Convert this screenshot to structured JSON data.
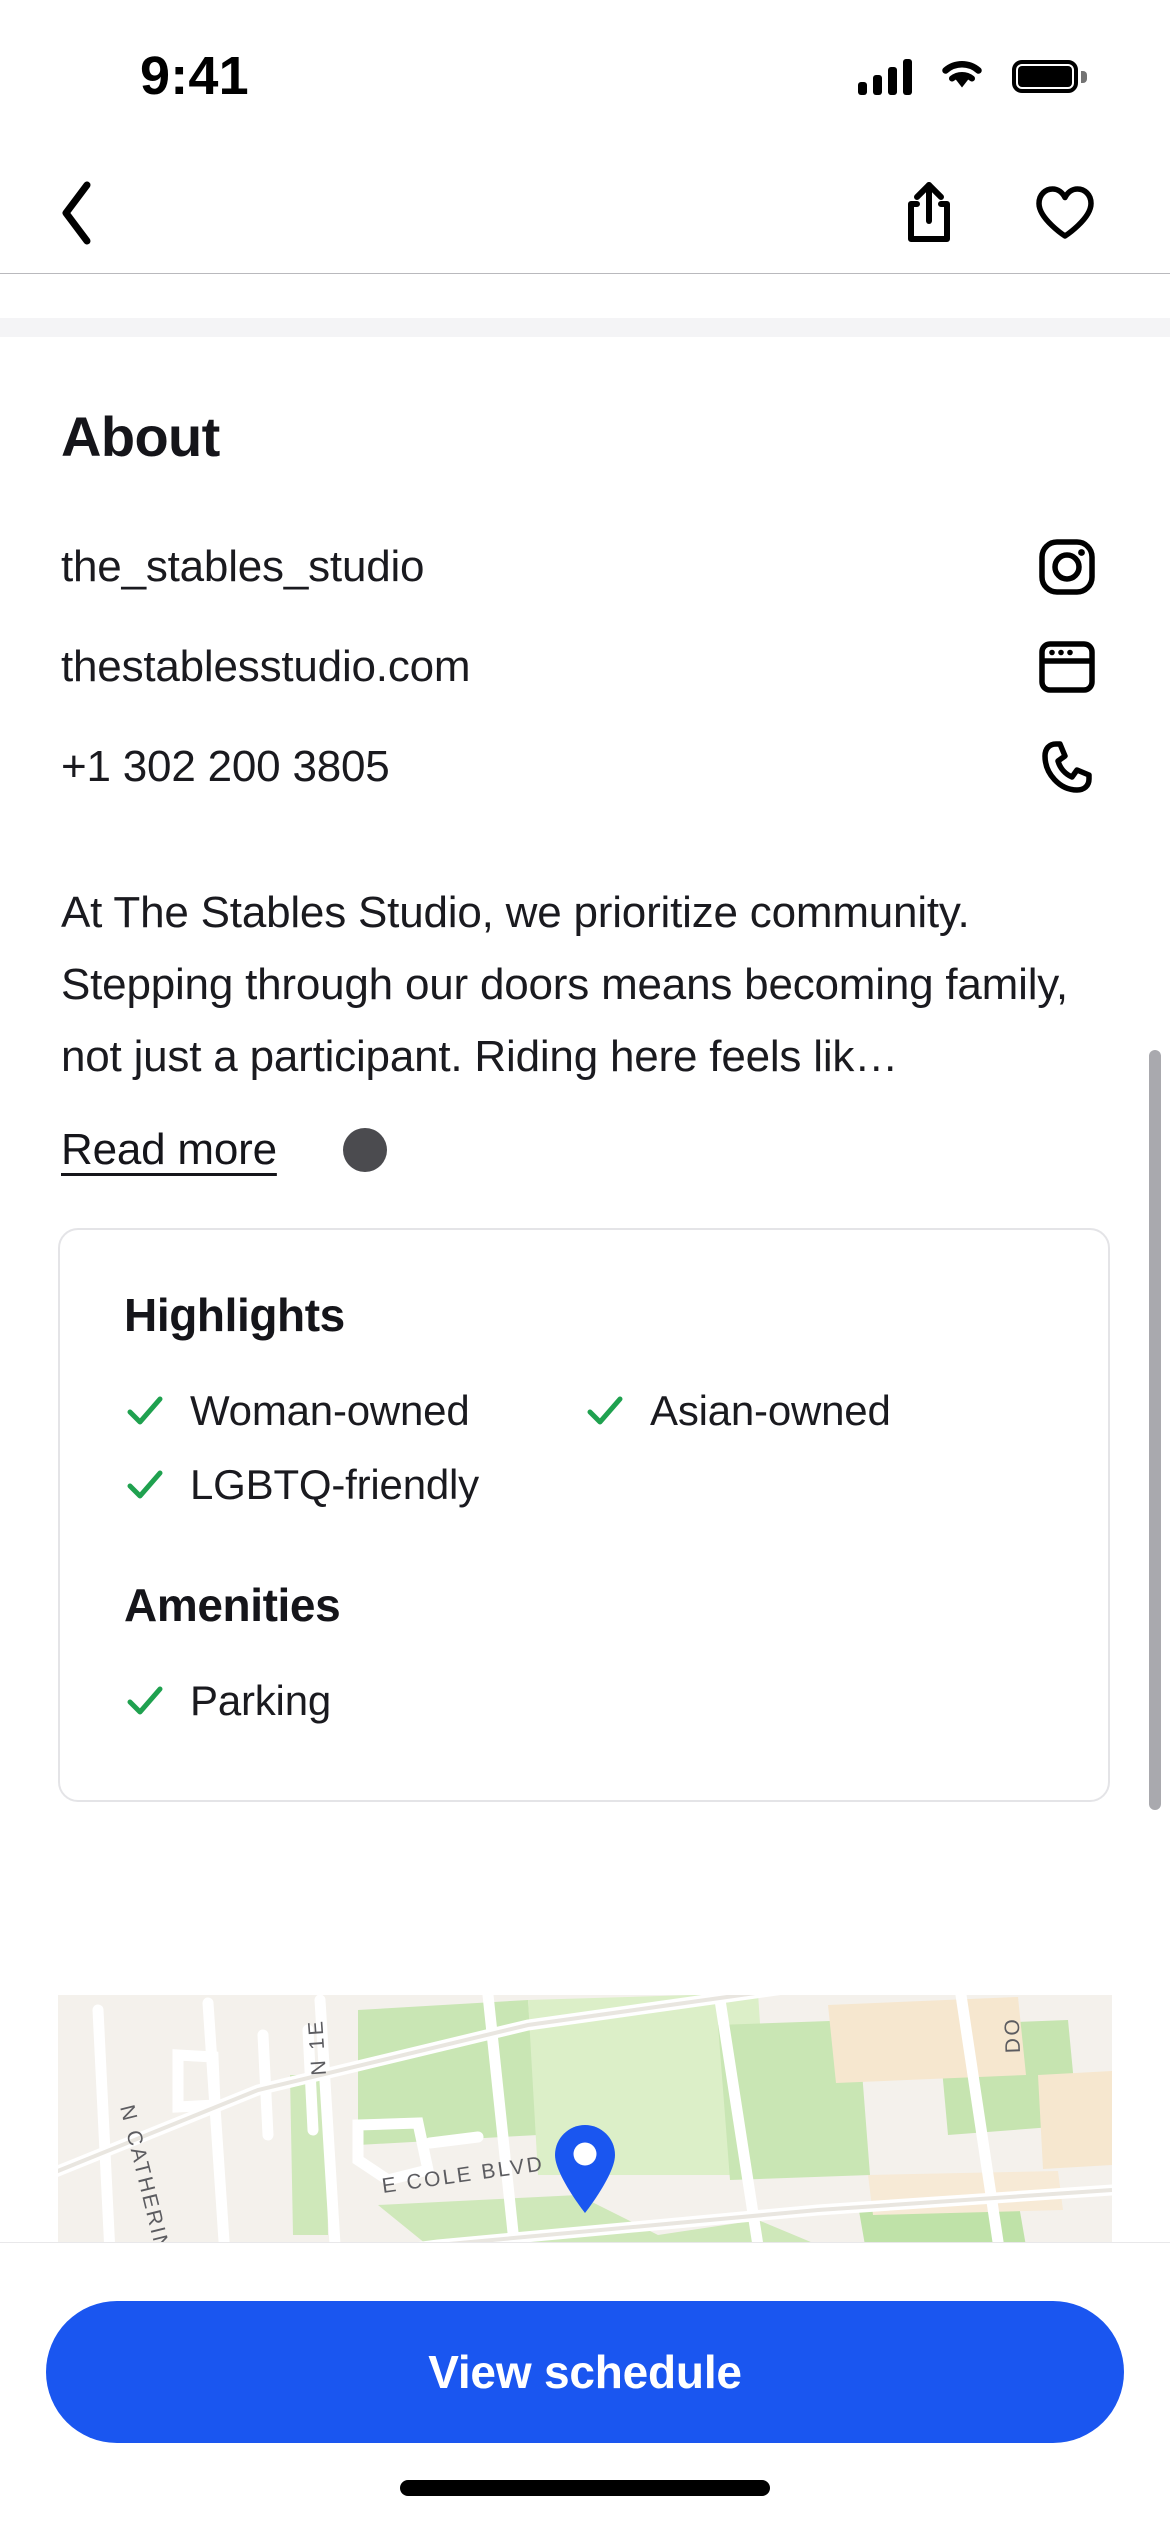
{
  "status_bar": {
    "time": "9:41",
    "cellular_icon": "signal-bars-icon",
    "wifi_icon": "wifi-icon",
    "battery_icon": "battery-icon"
  },
  "nav_bar": {
    "back_icon": "chevron-left-icon",
    "share_icon": "share-icon",
    "favorite_icon": "heart-icon"
  },
  "about": {
    "title": "About",
    "contacts": [
      {
        "text": "the_stables_studio",
        "icon": "instagram-icon"
      },
      {
        "text": "thestablesstudio.com",
        "icon": "browser-window-icon"
      },
      {
        "text": "+1 302 200 3805",
        "icon": "phone-icon"
      }
    ],
    "description": "At The Stables Studio, we prioritize community. Stepping through our doors means becoming family, not just a participant. Riding here feels lik…",
    "read_more_label": "Read more"
  },
  "info_card": {
    "highlights_heading": "Highlights",
    "highlights": [
      {
        "label": "Woman-owned",
        "icon": "check-icon"
      },
      {
        "label": "Asian-owned",
        "icon": "check-icon"
      },
      {
        "label": "LGBTQ-friendly",
        "icon": "check-icon"
      }
    ],
    "amenities_heading": "Amenities",
    "amenities": [
      {
        "label": "Parking",
        "icon": "check-icon"
      }
    ]
  },
  "map": {
    "pin_icon": "map-pin-icon",
    "street_labels": [
      "N CATHERINE ST",
      "E COLE BLVD",
      "N 1E",
      "DO"
    ]
  },
  "bottom_bar": {
    "cta_label": "View schedule"
  },
  "colors": {
    "accent_blue": "#1a56f0",
    "check_green": "#1fa14f",
    "text_primary": "#15151a",
    "card_border": "#e4e4e7",
    "cursor_dot": "#4b4b4f",
    "scrollbar": "#a9a9ae"
  }
}
